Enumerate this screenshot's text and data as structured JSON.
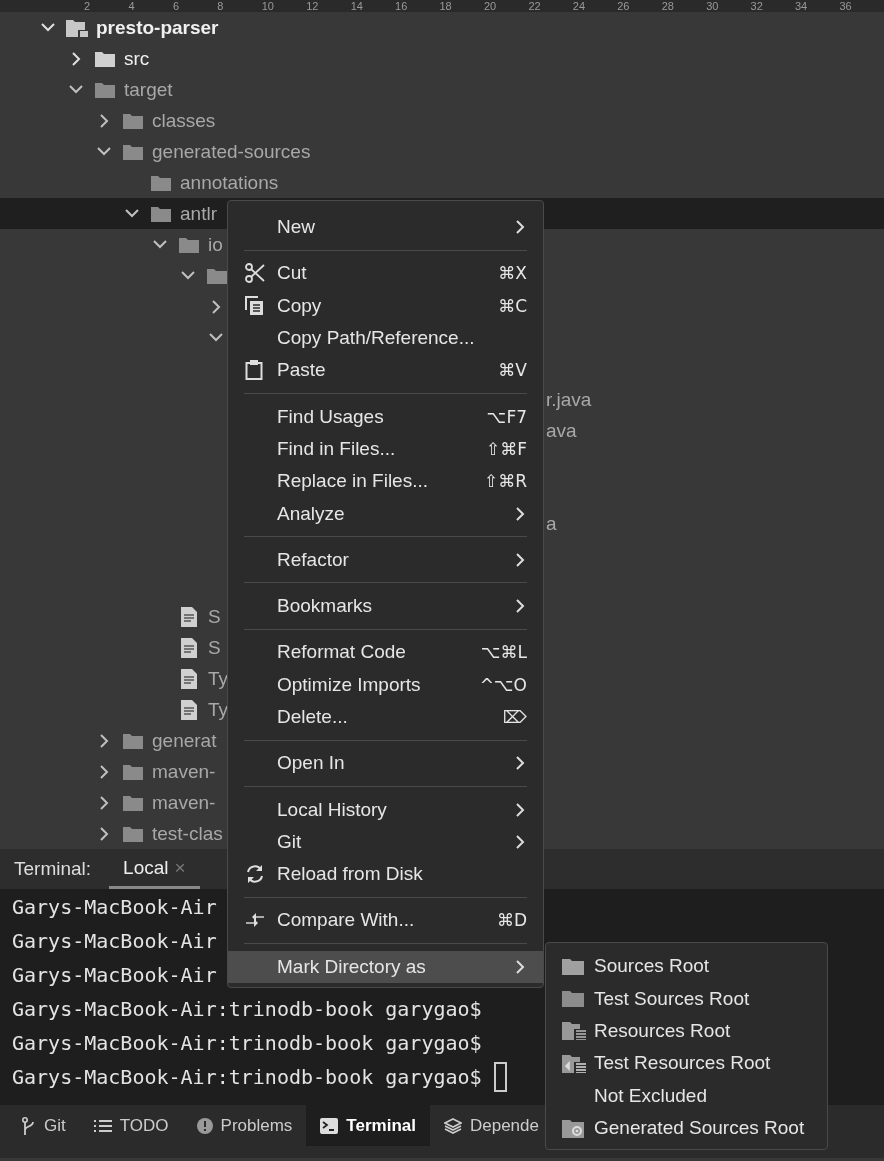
{
  "ruler": [
    "2",
    "4",
    "6",
    "8",
    "10",
    "12",
    "14",
    "16",
    "18",
    "20",
    "22",
    "24",
    "26",
    "28",
    "30",
    "32",
    "34",
    "36"
  ],
  "tree": [
    {
      "kind": "module",
      "label": "presto-parser",
      "expanded": true,
      "selected": false,
      "excluded": false,
      "children": [
        {
          "kind": "folder",
          "label": "src",
          "expanded": false,
          "selected": false,
          "excluded": false
        },
        {
          "kind": "folder",
          "label": "target",
          "expanded": true,
          "selected": false,
          "excluded": true,
          "children": [
            {
              "kind": "folder",
              "label": "classes",
              "expanded": false,
              "selected": false,
              "excluded": true
            },
            {
              "kind": "folder",
              "label": "generated-sources",
              "expanded": true,
              "selected": false,
              "excluded": true,
              "children": [
                {
                  "kind": "folder",
                  "label": "annotations",
                  "selected": false,
                  "excluded": true
                },
                {
                  "kind": "folder",
                  "label": "antlr",
                  "expanded": true,
                  "selected": true,
                  "excluded": true,
                  "children": [
                    {
                      "kind": "folder",
                      "label": "io",
                      "expanded": true,
                      "selected": false,
                      "excluded": true,
                      "children": [
                        {
                          "kind": "folder",
                          "expanded": true,
                          "selected": false,
                          "excluded": true,
                          "children": [
                            {
                              "kind": "covered",
                              "expanded": false
                            },
                            {
                              "kind": "covered",
                              "expanded": true,
                              "children": [
                                {
                                  "kind": "covered"
                                },
                                {
                                  "kind": "covered",
                                  "label": "r.java",
                                  "selected": false,
                                  "excluded": true
                                },
                                {
                                  "kind": "covered",
                                  "label": "ava",
                                  "selected": false,
                                  "excluded": true
                                },
                                {
                                  "kind": "covered"
                                },
                                {
                                  "kind": "covered"
                                },
                                {
                                  "kind": "covered",
                                  "label": "a",
                                  "selected": false,
                                  "excluded": true
                                },
                                {
                                  "kind": "covered"
                                },
                                {
                                  "kind": "covered"
                                }
                              ]
                            }
                          ]
                        }
                      ]
                    },
                    {
                      "kind": "file",
                      "label": "S",
                      "selected": false,
                      "excluded": true
                    },
                    {
                      "kind": "file",
                      "label": "S",
                      "selected": false,
                      "excluded": true
                    },
                    {
                      "kind": "file",
                      "label": "Ty",
                      "selected": false,
                      "excluded": true
                    },
                    {
                      "kind": "file",
                      "label": "Ty",
                      "selected": false,
                      "excluded": true
                    }
                  ]
                }
              ]
            },
            {
              "kind": "folder",
              "label": "generat",
              "expanded": false,
              "selected": false,
              "excluded": true
            },
            {
              "kind": "folder",
              "label": "maven-",
              "expanded": false,
              "selected": false,
              "excluded": true
            },
            {
              "kind": "folder",
              "label": "maven-",
              "expanded": false,
              "selected": false,
              "excluded": true
            },
            {
              "kind": "folder",
              "label": "test-clas",
              "expanded": false,
              "selected": false,
              "excluded": true
            }
          ]
        }
      ]
    }
  ],
  "context_menu": [
    {
      "kind": "item",
      "label": "New",
      "has_submenu": true,
      "selected": false
    },
    {
      "kind": "separator"
    },
    {
      "kind": "cut",
      "label": "Cut",
      "shortcut": "⌘X",
      "has_submenu": false,
      "selected": false
    },
    {
      "kind": "copy",
      "label": "Copy",
      "shortcut": "⌘C",
      "has_submenu": false,
      "selected": false
    },
    {
      "kind": "item",
      "label": "Copy Path/Reference...",
      "has_submenu": false,
      "selected": false
    },
    {
      "kind": "paste",
      "label": "Paste",
      "shortcut": "⌘V",
      "has_submenu": false,
      "selected": false
    },
    {
      "kind": "separator"
    },
    {
      "kind": "item",
      "label": "Find Usages",
      "shortcut": "⌥F7",
      "has_submenu": false,
      "selected": false
    },
    {
      "kind": "item",
      "label": "Find in Files...",
      "shortcut": "⇧⌘F",
      "has_submenu": false,
      "selected": false
    },
    {
      "kind": "item",
      "label": "Replace in Files...",
      "shortcut": "⇧⌘R",
      "has_submenu": false,
      "selected": false
    },
    {
      "kind": "item",
      "label": "Analyze",
      "has_submenu": true,
      "selected": false
    },
    {
      "kind": "separator"
    },
    {
      "kind": "item",
      "label": "Refactor",
      "has_submenu": true,
      "selected": false
    },
    {
      "kind": "separator"
    },
    {
      "kind": "item",
      "label": "Bookmarks",
      "has_submenu": true,
      "selected": false
    },
    {
      "kind": "separator"
    },
    {
      "kind": "item",
      "label": "Reformat Code",
      "shortcut": "⌥⌘L",
      "has_submenu": false,
      "selected": false
    },
    {
      "kind": "item",
      "label": "Optimize Imports",
      "shortcut": "^⌥O",
      "has_submenu": false,
      "selected": false
    },
    {
      "kind": "item",
      "label": "Delete...",
      "shortcut": "⌦",
      "has_submenu": false,
      "selected": false
    },
    {
      "kind": "separator"
    },
    {
      "kind": "item",
      "label": "Open In",
      "has_submenu": true,
      "selected": false
    },
    {
      "kind": "separator"
    },
    {
      "kind": "item",
      "label": "Local History",
      "has_submenu": true,
      "selected": false
    },
    {
      "kind": "item",
      "label": "Git",
      "has_submenu": true,
      "selected": false
    },
    {
      "kind": "reload",
      "label": "Reload from Disk",
      "has_submenu": false,
      "selected": false
    },
    {
      "kind": "separator"
    },
    {
      "kind": "compare",
      "label": "Compare With...",
      "shortcut": "⌘D",
      "has_submenu": false,
      "selected": false
    },
    {
      "kind": "separator"
    },
    {
      "kind": "item",
      "label": "Mark Directory as",
      "has_submenu": true,
      "selected": true
    }
  ],
  "submenu": [
    {
      "kind": "sources",
      "label": "Sources Root"
    },
    {
      "kind": "test-sources",
      "label": "Test Sources Root"
    },
    {
      "kind": "resources",
      "label": "Resources Root"
    },
    {
      "kind": "test-resources",
      "label": "Test Resources Root"
    },
    {
      "kind": "plain",
      "label": "Not Excluded"
    },
    {
      "kind": "generated",
      "label": "Generated Sources Root"
    }
  ],
  "terminal": {
    "title": "Terminal:",
    "tabs": [
      {
        "label": "Local",
        "close": "×",
        "selected": true
      }
    ],
    "lines": [
      "Garys-MacBook-Air",
      "Garys-MacBook-Air",
      "Garys-MacBook-Air",
      "Garys-MacBook-Air:trinodb-book garygao$",
      "Garys-MacBook-Air:trinodb-book garygao$",
      "Garys-MacBook-Air:trinodb-book garygao$"
    ],
    "cursor": true
  },
  "bottom_bar": [
    {
      "kind": "git",
      "label": "Git",
      "selected": false
    },
    {
      "kind": "todo",
      "label": "TODO",
      "selected": false
    },
    {
      "kind": "problems",
      "label": "Problems",
      "selected": false
    },
    {
      "kind": "terminal",
      "label": "Terminal",
      "selected": true
    },
    {
      "kind": "dependencies",
      "label": "Depende",
      "selected": false
    }
  ]
}
